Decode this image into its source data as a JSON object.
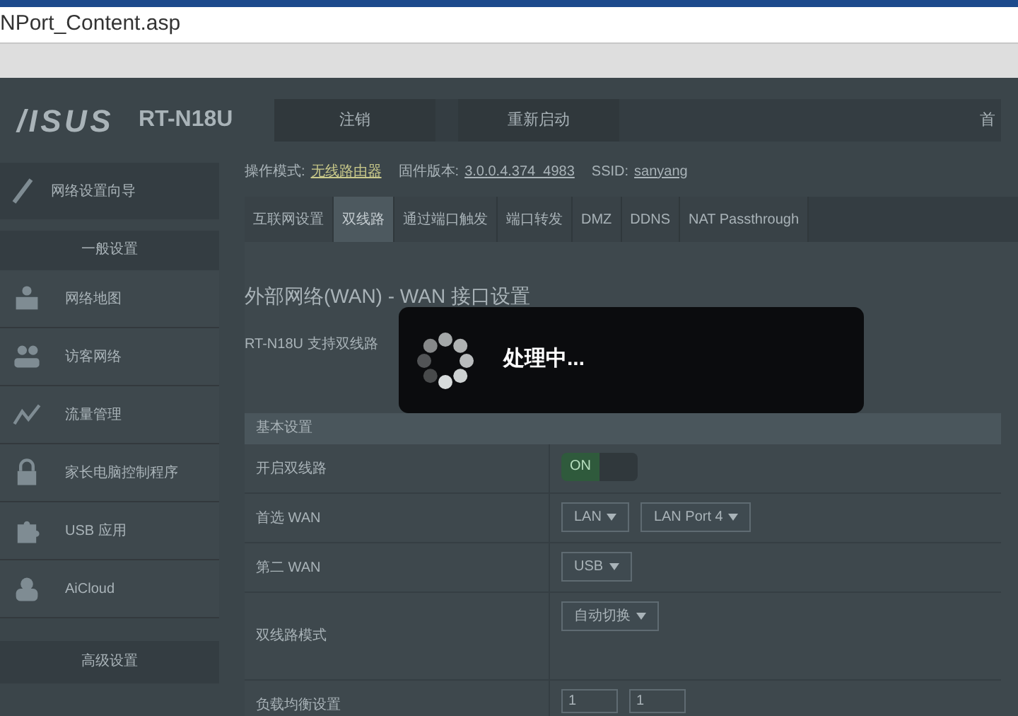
{
  "browser": {
    "address": "NPort_Content.asp"
  },
  "header": {
    "logo": "/ISUS",
    "model": "RT-N18U",
    "buttons": [
      "注销",
      "重新启动"
    ],
    "right_cut": "首"
  },
  "status": {
    "mode_label": "操作模式:",
    "mode": "无线路由器",
    "firmware_label": "固件版本:",
    "firmware": "3.0.0.4.374_4983",
    "ssid_label": "SSID:",
    "ssid": "sanyang"
  },
  "sidebar": {
    "wizard": "网络设置向导",
    "general_title": "一般设置",
    "items": [
      {
        "label": "网络地图"
      },
      {
        "label": "访客网络"
      },
      {
        "label": "流量管理"
      },
      {
        "label": "家长电脑控制程序"
      },
      {
        "label": "USB 应用"
      },
      {
        "label": "AiCloud"
      }
    ],
    "advanced_title": "高级设置"
  },
  "tabs": [
    {
      "label": "互联网设置",
      "selected": false
    },
    {
      "label": "双线路",
      "selected": true
    },
    {
      "label": "通过端口触发",
      "selected": false
    },
    {
      "label": "端口转发",
      "selected": false
    },
    {
      "label": "DMZ",
      "selected": false
    },
    {
      "label": "DDNS",
      "selected": false
    },
    {
      "label": "NAT Passthrough",
      "selected": false
    }
  ],
  "page_title": "外部网络(WAN) - WAN 接口设置",
  "description": [
    "RT-N18U 支持双线路"
  ],
  "section_title": "基本设置",
  "rows": [
    {
      "label": "开启双线路",
      "kind": "toggle",
      "on": true,
      "on_text": "ON"
    },
    {
      "label": "首选 WAN",
      "kind": "selects",
      "values": [
        "LAN",
        "LAN Port 4"
      ]
    },
    {
      "label": "第二 WAN",
      "kind": "selects",
      "values": [
        "USB"
      ]
    },
    {
      "label": "双线路模式",
      "kind": "select_hint",
      "values": [
        "自动切换"
      ]
    },
    {
      "label": "负载均衡设置",
      "kind": "ratio",
      "values": [
        "1",
        "1"
      ]
    }
  ],
  "dialog": {
    "message": "处理中..."
  }
}
